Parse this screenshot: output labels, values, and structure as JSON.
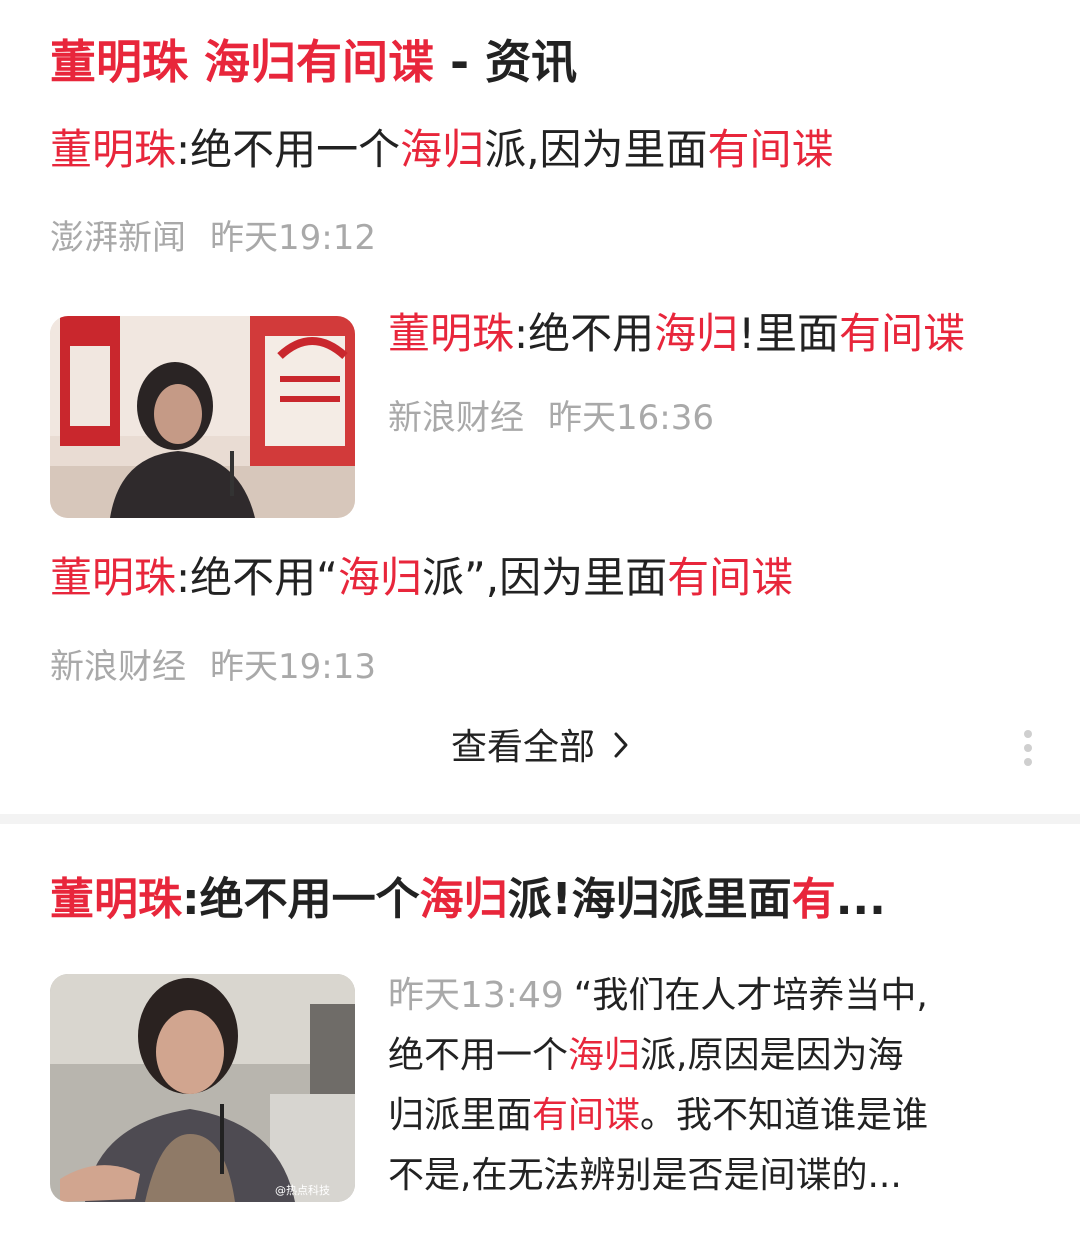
{
  "card": {
    "title_kw1": "董明珠",
    "title_kw2": "海归有间谍",
    "title_suffix": " - 资讯"
  },
  "news": [
    {
      "t1": "董明珠",
      "t2": ":绝不用一个",
      "t3": "海归",
      "t4": "派,因为里面",
      "t5": "有间谍",
      "source": "澎湃新闻",
      "time": "昨天19:12"
    },
    {
      "t1": "董明珠",
      "t2": ":绝不用",
      "t3": "海归",
      "t4": "!里面",
      "t5": "有间谍",
      "source": "新浪财经",
      "time": "昨天16:36"
    },
    {
      "t1": "董明珠",
      "t2": ":绝不用“",
      "t3": "海归",
      "t4": "派”,因为里面",
      "t5": "有间谍",
      "source": "新浪财经",
      "time": "昨天19:13"
    }
  ],
  "view_all": {
    "label": "查看全部",
    "icon": "chevron-right-icon"
  },
  "article": {
    "t1": "董明珠",
    "t2": ":绝不用一个",
    "t3": "海归",
    "t4": "派!海归派里面",
    "t5": "有",
    "ellipsis": "...",
    "time": "昨天13:49",
    "s1": "“我们在人才培养当中,",
    "s2": "绝不用一个",
    "s3": "海归",
    "s4": "派,原因是因为海",
    "s5": "归派里面",
    "s6": "有间谍",
    "s7": "。我不知道谁是谁",
    "s8": "不是,在无法辨别是否是间谍的...",
    "watermark": "@热点科技"
  },
  "colors": {
    "highlight": "#e8263b",
    "meta": "#a9a9a9",
    "text": "#222222"
  }
}
